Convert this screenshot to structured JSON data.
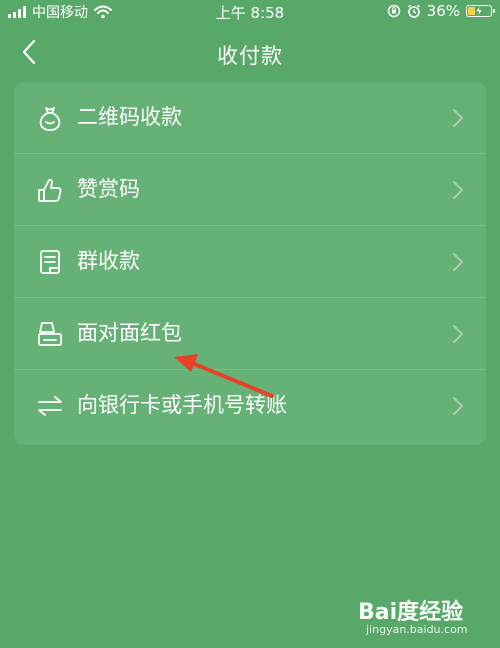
{
  "status_bar": {
    "carrier": "中国移动",
    "time": "上午 8:58",
    "battery_percent": "36%",
    "battery_level": 0.36,
    "icons": [
      "signal-icon",
      "wifi-icon",
      "orientation-lock-icon",
      "alarm-icon",
      "battery-charging-icon"
    ]
  },
  "nav": {
    "title": "收付款",
    "back_icon": "back-chevron-icon"
  },
  "menu": {
    "items": [
      {
        "label": "二维码收款",
        "icon": "money-bag-icon"
      },
      {
        "label": "赞赏码",
        "icon": "thumbs-up-icon"
      },
      {
        "label": "群收款",
        "icon": "group-receipt-icon"
      },
      {
        "label": "面对面红包",
        "icon": "red-packet-icon"
      },
      {
        "label": "向银行卡或手机号转账",
        "icon": "transfer-arrows-icon"
      }
    ]
  },
  "annotation": {
    "color": "#e8402a",
    "icon": "red-arrow-annotation"
  },
  "watermark": {
    "logo": "Bai度经验",
    "url": "jingyan.baidu.com"
  },
  "colors": {
    "background": "#58a86a",
    "card": "#65b176",
    "battery_fill": "#f5d44a"
  }
}
